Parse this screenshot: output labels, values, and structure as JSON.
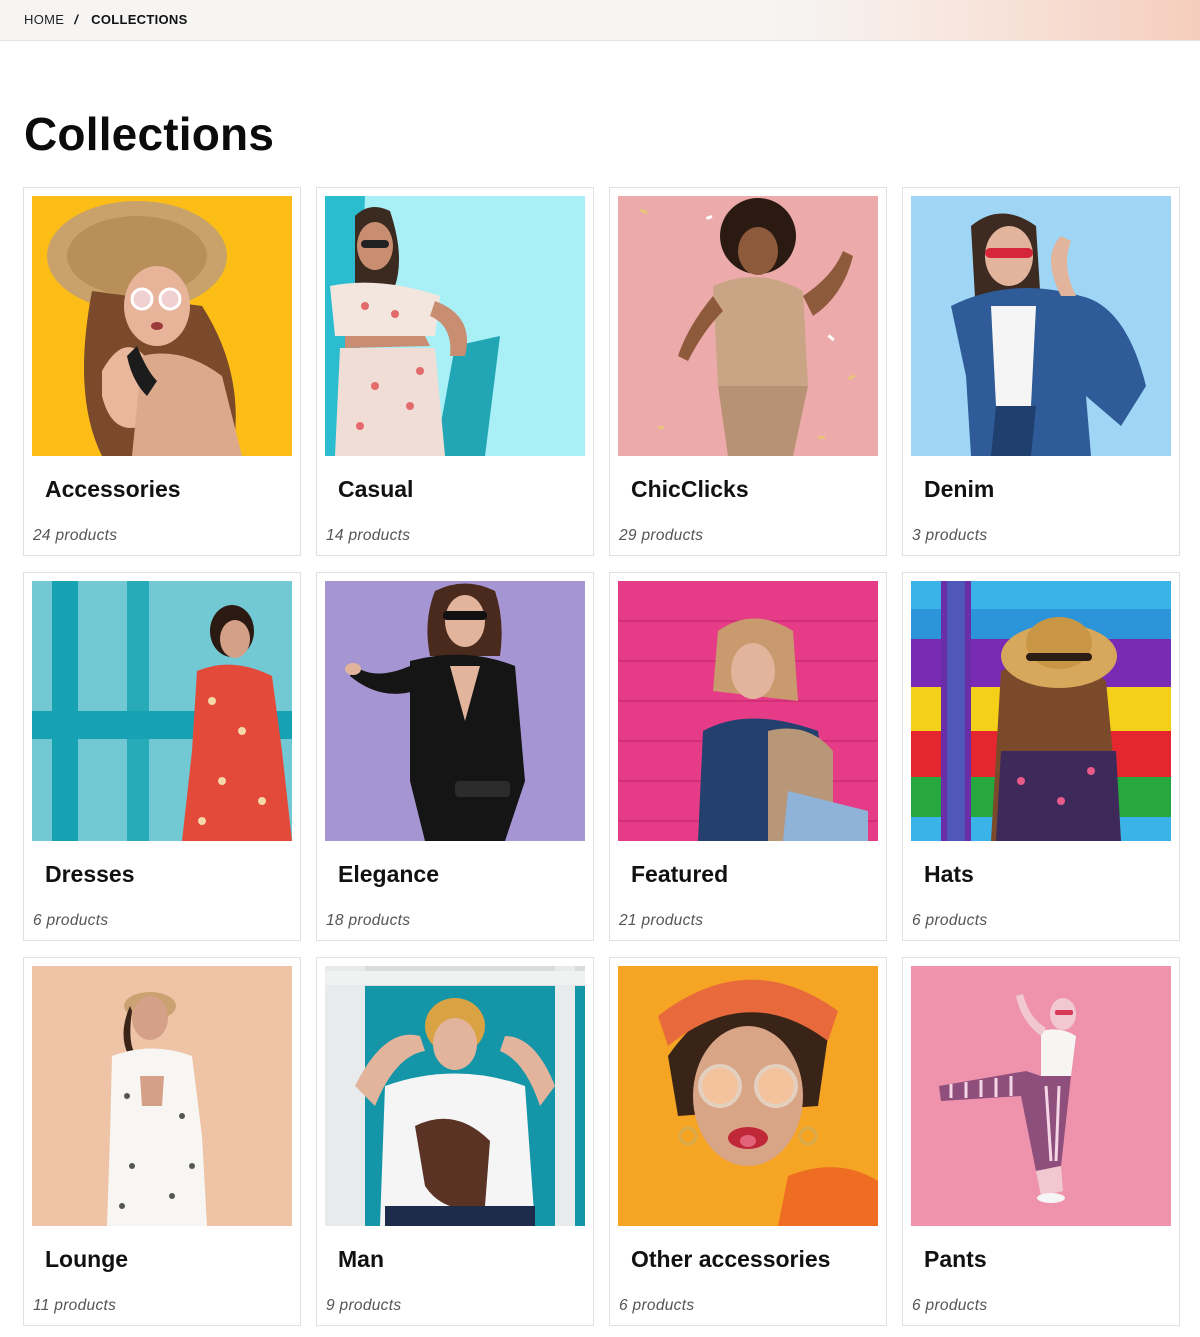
{
  "breadcrumb": {
    "home": "HOME",
    "separator": "/",
    "current": "COLLECTIONS"
  },
  "page": {
    "title": "Collections"
  },
  "colors": {
    "topbar": "#f6f5f4",
    "topbar_accent": "#f5cdbd",
    "card_border": "#e1e1e1"
  },
  "collections": [
    {
      "title": "Accessories",
      "count": "24 products",
      "bg": "#fcbd17",
      "icon": "woman-straw-hat-photo"
    },
    {
      "title": "Casual",
      "count": "14 products",
      "bg": "#a9eff6",
      "icon": "woman-floral-outfit-photo"
    },
    {
      "title": "ChicClicks",
      "count": "29 products",
      "bg": "#ecaaaa",
      "icon": "woman-sequin-dress-photo"
    },
    {
      "title": "Denim",
      "count": "3 products",
      "bg": "#9fd6f5",
      "icon": "woman-denim-jacket-photo"
    },
    {
      "title": "Dresses",
      "count": "6 products",
      "bg": "#16a2b2",
      "icon": "woman-red-floral-dress-photo"
    },
    {
      "title": "Elegance",
      "count": "18 products",
      "bg": "#a695d3",
      "icon": "woman-black-bodysuit-photo"
    },
    {
      "title": "Featured",
      "count": "21 products",
      "bg": "#e63b87",
      "icon": "woman-pink-wall-photo"
    },
    {
      "title": "Hats",
      "count": "6 products",
      "bg": "#2c94d8",
      "icon": "woman-rainbow-wall-hat-photo"
    },
    {
      "title": "Lounge",
      "count": "11 products",
      "bg": "#eec3a6",
      "icon": "woman-white-suit-photo"
    },
    {
      "title": "Man",
      "count": "9 products",
      "bg": "#1496a8",
      "icon": "man-white-tshirt-photo"
    },
    {
      "title": "Other accessories",
      "count": "6 products",
      "bg": "#f5a423",
      "icon": "woman-headscarf-photo"
    },
    {
      "title": "Pants",
      "count": "6 products",
      "bg": "#ee93ab",
      "icon": "woman-striped-pants-photo"
    }
  ]
}
